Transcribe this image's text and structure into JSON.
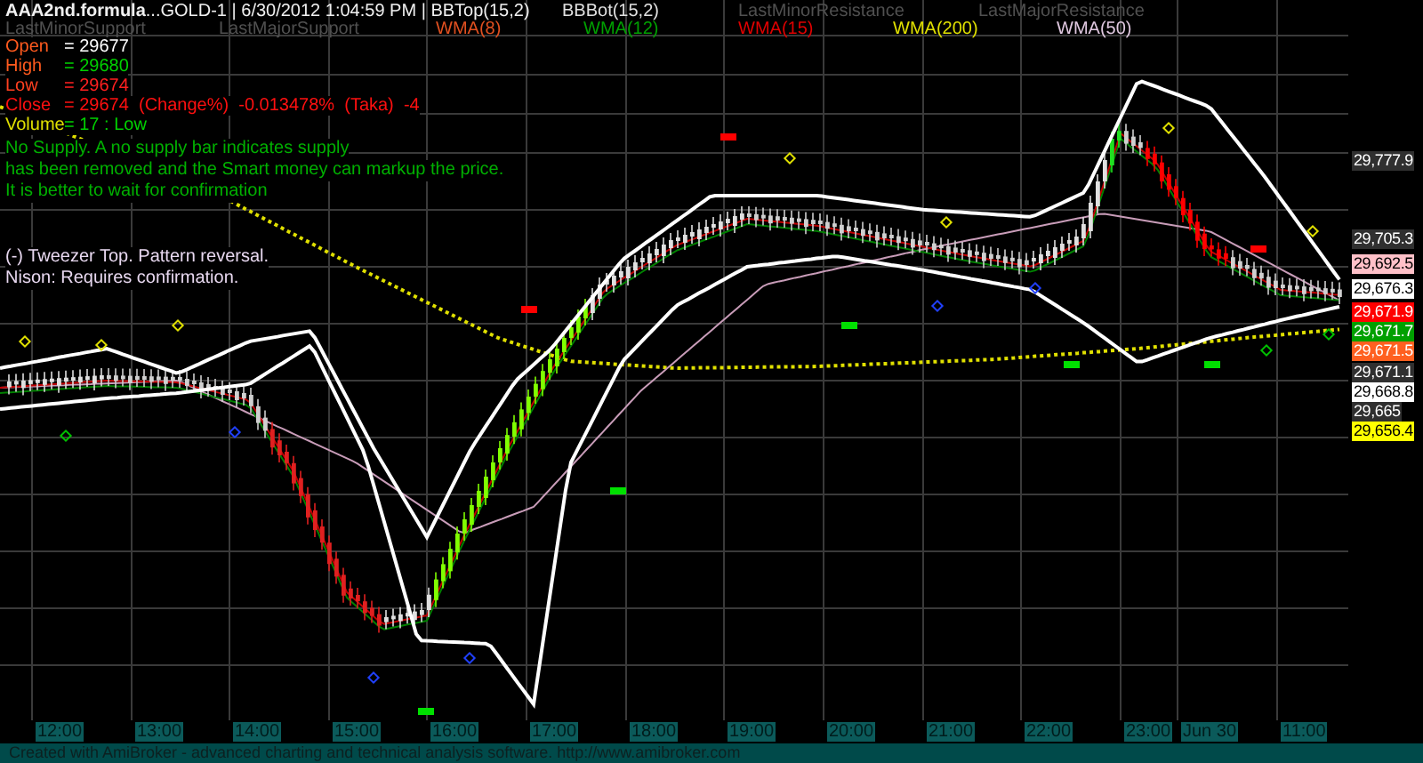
{
  "title": "**AAA2nd.formula**...GOLD-1 | 6/30/2012 1:04:59 PM | BBTop(15,2)",
  "legend": [
    {
      "label": "BBBot(15,2)",
      "color": "#e0e0e0"
    },
    {
      "label": "LastMinorResistance",
      "color": "#505050"
    },
    {
      "label": "LastMajorResistance",
      "color": "#505050"
    },
    {
      "label": "LastMinorSupport",
      "color": "#505050"
    },
    {
      "label": "LastMajorSupport",
      "color": "#505050"
    },
    {
      "label": "WMA(8)",
      "color": "#e05020"
    },
    {
      "label": "WMA(12)",
      "color": "#00a000"
    },
    {
      "label": "WMA(15)",
      "color": "#e00000"
    },
    {
      "label": "WMA(200)",
      "color": "#e0e000"
    },
    {
      "label": "WMA(50)",
      "color": "#e0c8e0"
    }
  ],
  "quote": [
    {
      "label": {
        "text": "Open",
        "color": "#ff5a1e"
      },
      "value": {
        "text": "= 29677",
        "color": "#ffffff"
      }
    },
    {
      "label": {
        "text": "High",
        "color": "#ff5a1e"
      },
      "value": {
        "text": "= 29680",
        "color": "#00d000"
      }
    },
    {
      "label": {
        "text": "Low",
        "color": "#ff4020"
      },
      "value": {
        "text": "= 29674",
        "color": "#ff2020"
      }
    },
    {
      "label": {
        "text": "Close",
        "color": "#ff1010"
      },
      "value": {
        "text": "= 29674  (Change%)  -0.013478%  (Taka)  -4",
        "color": "#ff1010"
      }
    },
    {
      "label": {
        "text": "Volume",
        "color": "#e0e000"
      },
      "value": {
        "text": "= 17 : Low",
        "color": "#00d000"
      }
    }
  ],
  "notes": [
    {
      "lines": [
        "No Supply. A no supply bar indicates supply",
        "has been removed and the Smart money can markup the price.",
        "It is better to wait for confirmation"
      ],
      "color": "#00b000"
    },
    {
      "lines": [
        "(-) Tweezer Top. Pattern reversal.",
        "Nison: Requires confirmation."
      ],
      "color": "#e8d8f0"
    }
  ],
  "price_labels": [
    {
      "text": "29,777.9",
      "color": "#303030"
    },
    {
      "text": "29,705.3",
      "color": "#303030"
    },
    {
      "text": "29,692.5",
      "color": "#ffc0c8"
    },
    {
      "text": "29,676.3",
      "color": "#ffffff"
    },
    {
      "text": "29,671.9",
      "color": "#ff0000"
    },
    {
      "text": "29,671.7",
      "color": "#00a000"
    },
    {
      "text": "29,671.5",
      "color": "#ff6020"
    },
    {
      "text": "29,671.1",
      "color": "#303030"
    },
    {
      "text": "29,668.8",
      "color": "#ffffff"
    },
    {
      "text": "29,665",
      "color": "#303030"
    },
    {
      "text": "29,656.4",
      "color": "#ffff00"
    }
  ],
  "time_labels": [
    "12:00",
    "13:00",
    "14:00",
    "15:00",
    "16:00",
    "17:00",
    "18:00",
    "19:00",
    "20:00",
    "21:00",
    "22:00",
    "23:00",
    "Jun 30",
    "11:00"
  ],
  "footer": "Created with AmiBroker - advanced charting and technical analysis software. http://www.amibroker.com"
}
